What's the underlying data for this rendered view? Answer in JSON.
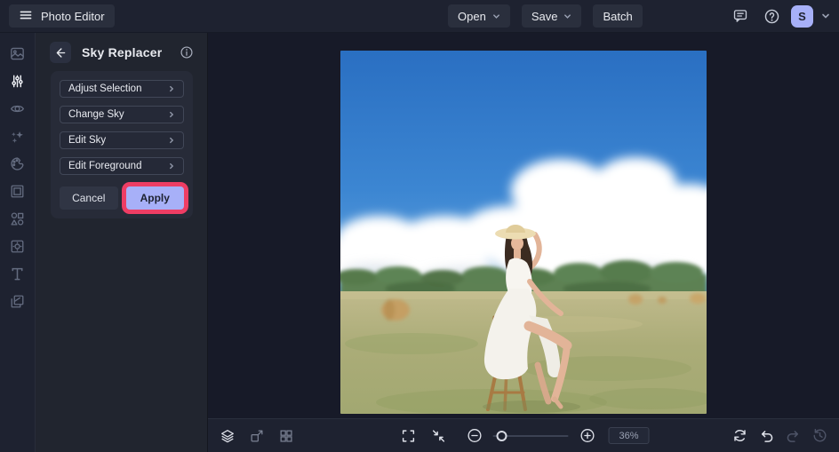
{
  "colors": {
    "topbar_bg": "#1e2230",
    "panel_bg": "#21252f",
    "canvas_bg": "#171a28",
    "chip_bg": "#2a2f3d",
    "accent_highlight_pink": "#ee3d64",
    "apply_periwinkle": "#a7b0f8",
    "avatar_periwinkle": "#a7b0f8",
    "active_icon": "#f0f2f7",
    "muted_icon": "#646c80"
  },
  "topbar": {
    "app_label": "Photo Editor",
    "open_label": "Open",
    "save_label": "Save",
    "batch_label": "Batch",
    "avatar_initial": "S",
    "icons": [
      "hamburger-icon",
      "feedback-icon",
      "help-icon",
      "chevron-down-icon"
    ]
  },
  "sidebar": {
    "items": [
      {
        "icon": "image-icon",
        "active": false
      },
      {
        "icon": "adjust-sliders-icon",
        "active": true
      },
      {
        "icon": "touchup-eye-icon",
        "active": false
      },
      {
        "icon": "effects-sparkles-icon",
        "active": false
      },
      {
        "icon": "artsy-palette-icon",
        "active": false
      },
      {
        "icon": "frames-icon",
        "active": false
      },
      {
        "icon": "graphics-shapes-icon",
        "active": false
      },
      {
        "icon": "overlays-icon",
        "active": false
      },
      {
        "icon": "text-icon",
        "active": false
      },
      {
        "icon": "textures-icon",
        "active": false
      }
    ]
  },
  "panel": {
    "title": "Sky Replacer",
    "items": [
      {
        "label": "Adjust Selection"
      },
      {
        "label": "Change Sky"
      },
      {
        "label": "Edit Sky"
      },
      {
        "label": "Edit Foreground"
      }
    ],
    "cancel_label": "Cancel",
    "apply_label": "Apply",
    "apply_highlighted": true
  },
  "canvas": {
    "photo_description": "Woman in a white dress and straw hat sitting on a wooden stool in a grassy field, large white clouds in a blue sky, tree line and hay bales at the horizon"
  },
  "bottombar": {
    "zoom_percent": "36%",
    "left_icons": [
      "layers-icon",
      "resize-canvas-icon",
      "grid-icon"
    ],
    "center_icons": [
      "fullscreen-icon",
      "fit-screen-icon",
      "zoom-out-icon",
      "zoom-in-icon"
    ],
    "right_icons": [
      "reset-icon",
      "undo-icon",
      "redo-icon",
      "history-icon"
    ],
    "undo_enabled": true,
    "redo_enabled": false
  }
}
